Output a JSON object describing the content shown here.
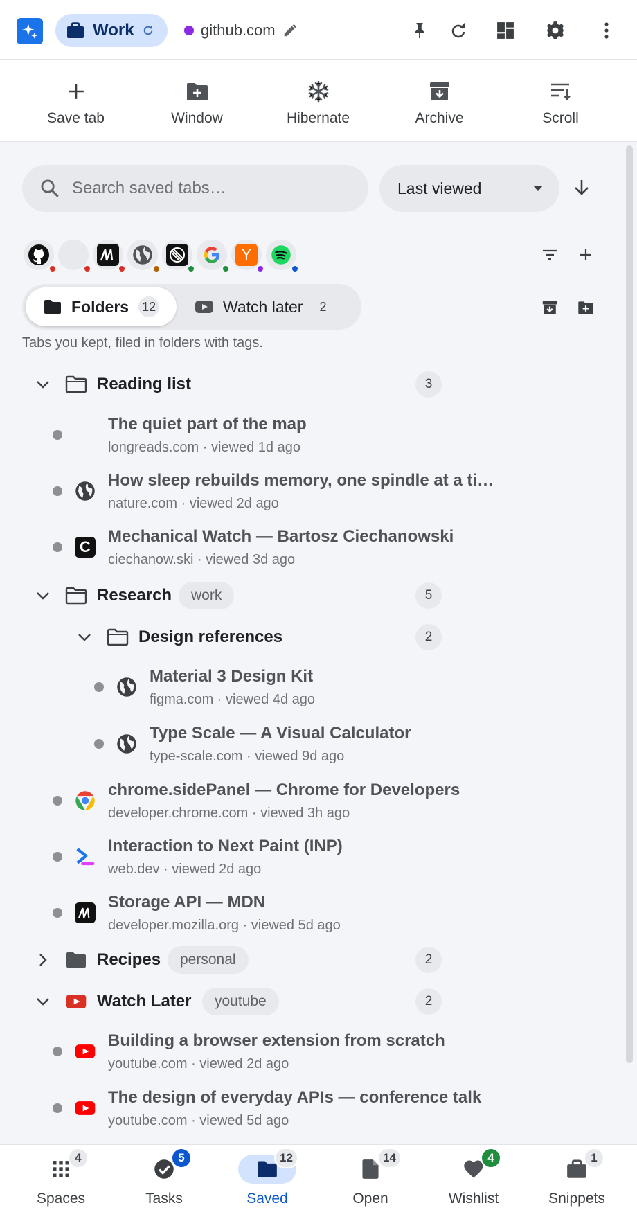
{
  "topbar": {
    "space_name": "Work",
    "site": "github.com",
    "site_dot_color": "#8a2be2",
    "icons": [
      "app-logo",
      "briefcase-icon",
      "sync-icon",
      "edit-icon",
      "pin-icon",
      "refresh-icon",
      "layout-icon",
      "gear-icon",
      "more-vert-icon"
    ]
  },
  "actions": [
    {
      "label": "Save tab",
      "icon": "plus-icon"
    },
    {
      "label": "Window",
      "icon": "folder-add-icon"
    },
    {
      "label": "Hibernate",
      "icon": "snowflake-icon"
    },
    {
      "label": "Archive",
      "icon": "archive-icon"
    },
    {
      "label": "Scroll",
      "icon": "sort-list-icon"
    }
  ],
  "search": {
    "placeholder": "Search saved tabs…"
  },
  "sort": {
    "label": "Last viewed"
  },
  "favicons": [
    {
      "name": "github",
      "dot": "#d93025"
    },
    {
      "name": "blank",
      "dot": "#d93025"
    },
    {
      "name": "mdn",
      "dot": "#d93025"
    },
    {
      "name": "globe",
      "dot": "#b06000"
    },
    {
      "name": "linear",
      "dot": "#1e8e3e"
    },
    {
      "name": "google",
      "dot": "#1e8e3e"
    },
    {
      "name": "ycombinator",
      "dot": "#8a2be2",
      "letter": "Y"
    },
    {
      "name": "spotify",
      "dot": "#0b57d0"
    }
  ],
  "segments": {
    "folders": {
      "label": "Folders",
      "count": "12"
    },
    "watch_later": {
      "label": "Watch later",
      "count": "2"
    }
  },
  "hint": "Tabs you kept, filed in folders with tags.",
  "tree": {
    "reading_list": {
      "name": "Reading list",
      "count": "3",
      "items": [
        {
          "title": "The quiet part of the map",
          "meta": "longreads.com · viewed 1d ago"
        },
        {
          "title": "How sleep rebuilds memory, one spindle at a ti…",
          "meta": "nature.com · viewed 2d ago"
        },
        {
          "title": "Mechanical Watch — Bartosz Ciechanowski",
          "meta": "ciechanow.ski · viewed 3d ago",
          "letter": "C"
        }
      ]
    },
    "research": {
      "name": "Research",
      "tag": "work",
      "count": "5",
      "sub": {
        "name": "Design references",
        "count": "2",
        "items": [
          {
            "title": "Material 3 Design Kit",
            "meta": "figma.com · viewed 4d ago"
          },
          {
            "title": "Type Scale — A Visual Calculator",
            "meta": "type-scale.com · viewed 9d ago"
          }
        ]
      },
      "items": [
        {
          "title": "chrome.sidePanel — Chrome for Developers",
          "meta": "developer.chrome.com · viewed 3h ago"
        },
        {
          "title": "Interaction to Next Paint (INP)",
          "meta": "web.dev · viewed 2d ago"
        },
        {
          "title": "Storage API — MDN",
          "meta": "developer.mozilla.org · viewed 5d ago"
        }
      ]
    },
    "recipes": {
      "name": "Recipes",
      "tag": "personal",
      "count": "2"
    },
    "watch_later": {
      "name": "Watch Later",
      "tag": "youtube",
      "count": "2",
      "items": [
        {
          "title": "Building a browser extension from scratch",
          "meta": "youtube.com · viewed 2d ago"
        },
        {
          "title": "The design of everyday APIs — conference talk",
          "meta": "youtube.com · viewed 5d ago"
        }
      ]
    }
  },
  "nav": [
    {
      "label": "Spaces",
      "badge": "4"
    },
    {
      "label": "Tasks",
      "badge": "5"
    },
    {
      "label": "Saved",
      "badge": "12"
    },
    {
      "label": "Open",
      "badge": "14"
    },
    {
      "label": "Wishlist",
      "badge": "4"
    },
    {
      "label": "Snippets",
      "badge": "1"
    }
  ],
  "colors": {
    "accent": "#0b57d0",
    "accent_soft": "#d3e3fd",
    "youtube": "#ff0000"
  }
}
